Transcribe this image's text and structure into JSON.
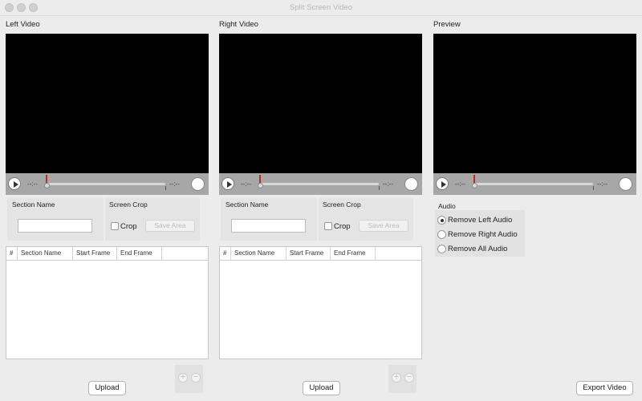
{
  "window": {
    "title": "Split Screen Video"
  },
  "left": {
    "label": "Left Video",
    "time_current": "--:--",
    "time_remaining": "--:--",
    "section_name_label": "Section Name",
    "section_name_value": "",
    "screen_crop_label": "Screen Crop",
    "crop_label": "Crop",
    "crop_checked": false,
    "save_area_label": "Save Area",
    "table_headers": [
      "#",
      "Section Name",
      "Start Frame",
      "End Frame"
    ],
    "rows": [],
    "upload_label": "Upload",
    "add_label": "+",
    "remove_label": "−"
  },
  "right": {
    "label": "Right Video",
    "time_current": "--:--",
    "time_remaining": "--:--",
    "section_name_label": "Section Name",
    "section_name_value": "",
    "screen_crop_label": "Screen Crop",
    "crop_label": "Crop",
    "crop_checked": false,
    "save_area_label": "Save Area",
    "table_headers": [
      "#",
      "Section Name",
      "Start Frame",
      "End Frame"
    ],
    "rows": [],
    "upload_label": "Upload",
    "add_label": "+",
    "remove_label": "−"
  },
  "preview": {
    "label": "Preview",
    "time_current": "--:--",
    "time_remaining": "--:--",
    "audio_label": "Audio",
    "audio_options": [
      "Remove Left Audio",
      "Remove Right Audio",
      "Remove All Audio"
    ],
    "audio_selected": "Remove Left Audio",
    "export_label": "Export Video"
  }
}
